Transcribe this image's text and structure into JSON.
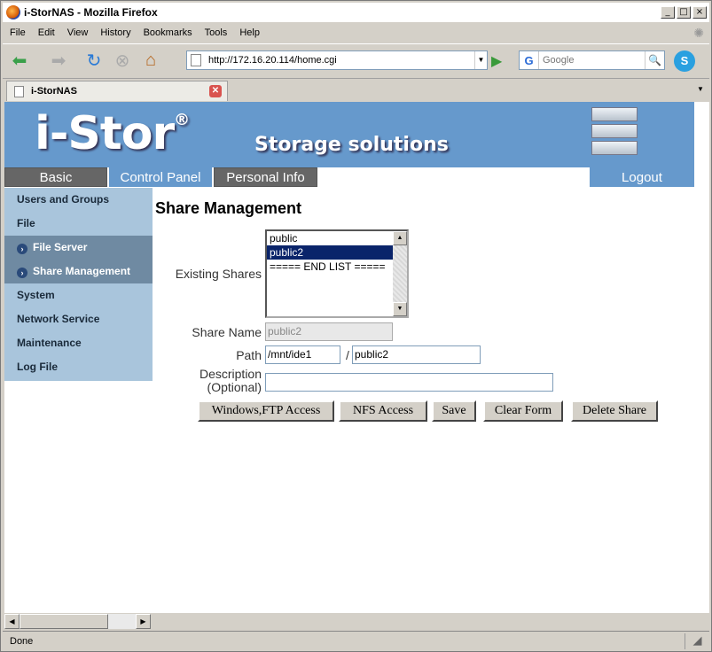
{
  "window": {
    "title": "i-StorNAS - Mozilla Firefox",
    "min": "_",
    "max": "□",
    "close": "×"
  },
  "menu": [
    "File",
    "Edit",
    "View",
    "History",
    "Bookmarks",
    "Tools",
    "Help"
  ],
  "toolbar": {
    "url": "http://172.16.20.114/home.cgi",
    "search_engine": "G",
    "search_placeholder": "Google"
  },
  "tab": {
    "label": "i-StorNAS"
  },
  "banner": {
    "logo": "i-Stor",
    "reg": "®",
    "slogan": "Storage solutions"
  },
  "mainnav": {
    "basic": "Basic",
    "control_panel": "Control Panel",
    "personal_info": "Personal Info",
    "logout": "Logout"
  },
  "sidebar": {
    "items": [
      {
        "label": "Users and Groups"
      },
      {
        "label": "File"
      },
      {
        "label": "File Server"
      },
      {
        "label": "Share Management"
      },
      {
        "label": "System"
      },
      {
        "label": "Network Service"
      },
      {
        "label": "Maintenance"
      },
      {
        "label": "Log File"
      }
    ]
  },
  "main": {
    "title": "Share Management",
    "existing_label": "Existing Shares",
    "shares": [
      "public",
      "public2",
      "===== END LIST ====="
    ],
    "selected_share": "public2",
    "share_name_label": "Share Name",
    "share_name_value": "public2",
    "path_label": "Path",
    "path_prefix": "/mnt/ide1",
    "path_sep": "/",
    "path_value": "public2",
    "description_label": "Description",
    "description_optional": "(Optional)",
    "description_value": "",
    "buttons": {
      "windows_ftp": "Windows,FTP Access",
      "nfs": "NFS Access",
      "save": "Save",
      "clear": "Clear Form",
      "delete": "Delete Share"
    }
  },
  "status": {
    "text": "Done"
  }
}
